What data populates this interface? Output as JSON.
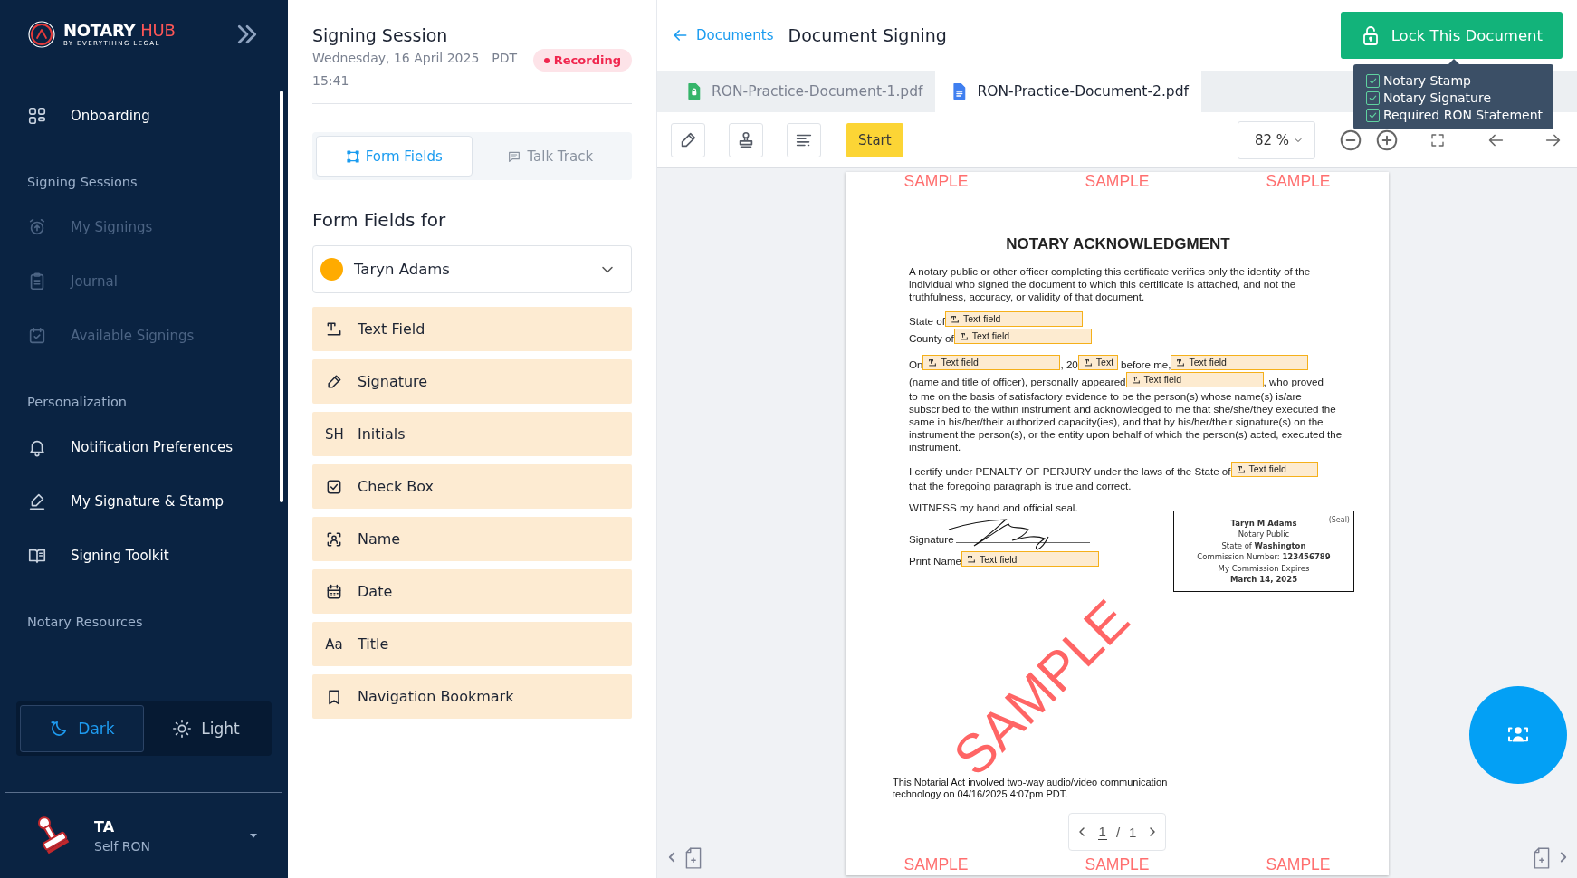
{
  "sidebar": {
    "brand": {
      "name": "NOTARY",
      "accent": "HUB",
      "tagline": "BY EVERYTHING LEGAL"
    },
    "groups": [
      {
        "items": [
          {
            "label": "Onboarding",
            "disabled": false
          }
        ]
      },
      {
        "heading": "Signing Sessions",
        "items": [
          {
            "label": "My Signings",
            "disabled": true
          },
          {
            "label": "Journal",
            "disabled": true
          },
          {
            "label": "Available Signings",
            "disabled": true
          }
        ]
      },
      {
        "heading": "Personalization",
        "items": [
          {
            "label": "Notification Preferences",
            "disabled": false
          },
          {
            "label": "My Signature & Stamp",
            "disabled": false
          },
          {
            "label": "Signing Toolkit",
            "disabled": false
          }
        ]
      },
      {
        "heading": "Notary Resources"
      }
    ],
    "theme": [
      {
        "label": "Dark",
        "selected": true
      },
      {
        "label": "Light",
        "selected": false
      }
    ],
    "user": {
      "initials": "TA",
      "role": "Self RON"
    }
  },
  "session": {
    "title": "Signing Session",
    "date": "Wednesday, 16 April 2025",
    "timezone": "PDT",
    "time": "15:41",
    "badge": "Recording"
  },
  "panel_tabs": [
    {
      "label": "Form Fields",
      "selected": true
    },
    {
      "label": "Talk Track",
      "selected": false
    }
  ],
  "form_fields": {
    "heading": "Form Fields for",
    "signer": {
      "name": "Taryn Adams",
      "color": "#ffab00"
    },
    "items": [
      {
        "kind": "text",
        "label": "Text Field"
      },
      {
        "kind": "signature",
        "label": "Signature"
      },
      {
        "kind": "initials",
        "label": "Initials",
        "icon_text": "SH"
      },
      {
        "kind": "checkbox",
        "label": "Check Box"
      },
      {
        "kind": "name",
        "label": "Name"
      },
      {
        "kind": "date",
        "label": "Date"
      },
      {
        "kind": "title",
        "label": "Title",
        "icon_text": "Aa"
      },
      {
        "kind": "bookmark",
        "label": "Navigation Bookmark"
      }
    ]
  },
  "header": {
    "back_link": "Documents",
    "title": "Document Signing",
    "lock_button": "Lock This Document",
    "checklist": [
      {
        "label": "Notary Stamp",
        "checked": true
      },
      {
        "label": "Notary Signature",
        "checked": true
      },
      {
        "label": "Required RON Statement",
        "checked": true
      }
    ]
  },
  "doc_tabs": [
    {
      "name": "RON-Practice-Document-1.pdf",
      "locked": true,
      "selected": false
    },
    {
      "name": "RON-Practice-Document-2.pdf",
      "locked": false,
      "selected": true
    }
  ],
  "toolbar": {
    "start_button": "Start",
    "zoom": "82 %"
  },
  "document": {
    "top_marks": [
      "SAMPLE",
      "SAMPLE",
      "SAMPLE"
    ],
    "title": "NOTARY ACKNOWLEDGMENT",
    "intro": "A notary public or other officer completing this certificate verifies only the identity of the individual who signed the document to which this certificate is attached, and not the truthfulness, accuracy, or validity of that document.",
    "paragraphs": [
      {
        "lines": [
          [
            {
              "kind": "text",
              "text": "State of"
            },
            {
              "kind": "blank",
              "field": "Text field"
            }
          ],
          [
            {
              "kind": "text",
              "text": "County of"
            },
            {
              "kind": "blank",
              "field": "Text field"
            }
          ]
        ]
      },
      {
        "lines": [
          [
            {
              "kind": "text",
              "text": "On"
            },
            {
              "kind": "blank",
              "field": "Text field"
            },
            {
              "kind": "text",
              "text": ", 20"
            },
            {
              "kind": "short_blank",
              "field": "Text"
            },
            {
              "kind": "text",
              "text": "before me,"
            },
            {
              "kind": "blank",
              "field": "Text field"
            }
          ],
          [
            {
              "kind": "text",
              "text": "(name and title of officer), personally appeared"
            },
            {
              "kind": "blank",
              "field": "Text field"
            },
            {
              "kind": "text",
              "text": ", who proved"
            }
          ],
          [
            {
              "kind": "text",
              "text": "to me on the basis of satisfactory evidence to be the person(s) whose name(s) is/are subscribed to the within instrument and acknowledged to me that she/she/they executed the same in his/her/their authorized capacity(ies), and that by his/her/their signature(s) on the instrument the person(s), or the entity upon behalf of which the person(s) acted, executed the instrument."
            }
          ]
        ]
      },
      {
        "lines": [
          [
            {
              "kind": "text",
              "text": "I certify under PENALTY OF PERJURY under the laws of the State of"
            },
            {
              "kind": "medium_blank",
              "field": "Text field"
            }
          ],
          [
            {
              "kind": "text",
              "text": "that the foregoing paragraph is true and correct."
            }
          ]
        ]
      },
      {
        "lines": [
          [
            {
              "kind": "text",
              "text": "WITNESS my hand and official seal."
            }
          ]
        ]
      }
    ],
    "signature_lines": [
      [
        {
          "kind": "text",
          "text": "Signature"
        },
        {
          "kind": "blank",
          "signed": true
        }
      ],
      [
        {
          "kind": "text",
          "text": "Print Name"
        },
        {
          "kind": "blank",
          "field": "Text field"
        }
      ]
    ],
    "seal": {
      "lines": [
        "Taryn M Adams",
        "Notary Public",
        "State of **Washington**",
        "Commission Number: **123456789**",
        "My Commission Expires",
        "March 14, 2025"
      ],
      "label": "(Seal)"
    },
    "diagonal_mark": "SAMPLE",
    "footer": "This Notarial Act involved two-way audio/video communication technology on 04/16/2025 4:07pm PDT.",
    "bottom_marks": [
      "SAMPLE",
      "SAMPLE",
      "SAMPLE"
    ]
  },
  "page_nav": {
    "current": "1",
    "separator": "/",
    "total": "1"
  }
}
